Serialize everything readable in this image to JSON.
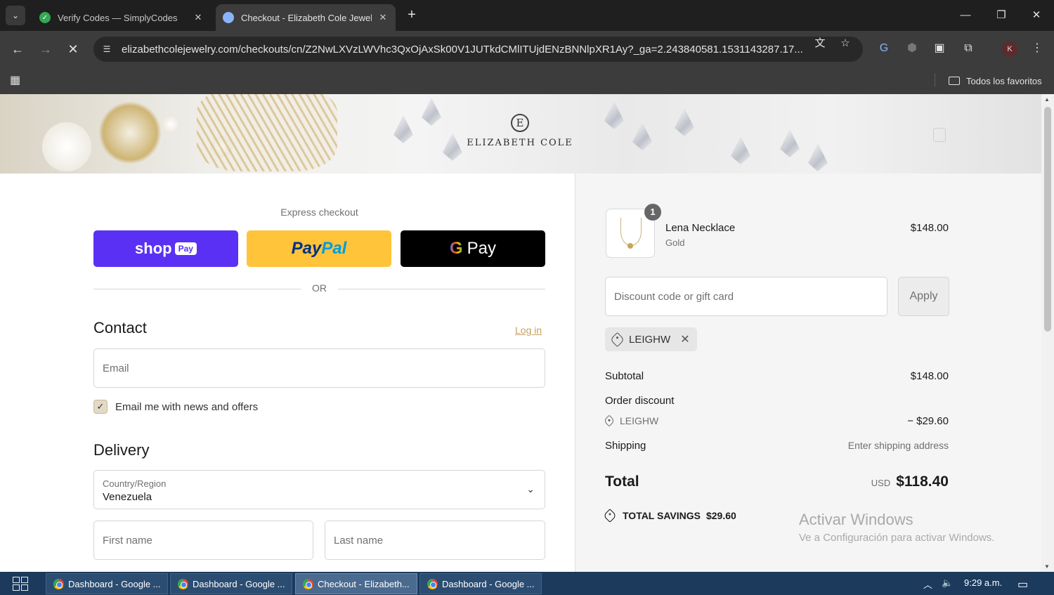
{
  "browser": {
    "tabs": [
      {
        "title": "Verify Codes — SimplyCodes",
        "active": false,
        "favicon_color": "#34a853"
      },
      {
        "title": "Checkout - Elizabeth Cole Jewel",
        "active": true,
        "favicon_color": "#8ab4f8"
      }
    ],
    "url": "elizabethcolejewelry.com/checkouts/cn/Z2NwLXVzLWVhc3QxOjAxSk00V1JUTkdCMlITUjdENzBNNlpXR1Ay?_ga=2.243840581.1531143287.17...",
    "profile_initial": "K",
    "bookmarks_folder": "Todos los favoritos"
  },
  "store": {
    "logo_text": "ELIZABETH COLE",
    "logo_mark": "E"
  },
  "checkout": {
    "express_label": "Express checkout",
    "shop_pay": {
      "word": "shop",
      "badge": "Pay"
    },
    "paypal": {
      "part1": "Pay",
      "part2": "Pal"
    },
    "gpay": {
      "g": "G",
      "pay": "Pay"
    },
    "or_label": "OR",
    "contact_heading": "Contact",
    "login_link": "Log in",
    "email_placeholder": "Email",
    "newsletter_label": "Email me with news and offers",
    "newsletter_checked": true,
    "delivery_heading": "Delivery",
    "country_label": "Country/Region",
    "country_value": "Venezuela",
    "first_name_placeholder": "First name",
    "last_name_placeholder": "Last name"
  },
  "summary": {
    "product": {
      "name": "Lena Necklace",
      "variant": "Gold",
      "price": "$148.00",
      "quantity": "1"
    },
    "discount_placeholder": "Discount code or gift card",
    "apply_label": "Apply",
    "applied_code": "LEIGHW",
    "subtotal_label": "Subtotal",
    "subtotal_value": "$148.00",
    "order_discount_label": "Order discount",
    "discount_code": "LEIGHW",
    "discount_value": "− $29.60",
    "shipping_label": "Shipping",
    "shipping_value": "Enter shipping address",
    "total_label": "Total",
    "total_currency": "USD",
    "total_value": "$118.40",
    "savings_label": "TOTAL SAVINGS",
    "savings_value": "$29.60"
  },
  "watermark": {
    "line1": "Activar Windows",
    "line2": "Ve a Configuración para activar Windows."
  },
  "taskbar": {
    "items": [
      {
        "label": "Dashboard - Google ...",
        "active": false
      },
      {
        "label": "Dashboard - Google ...",
        "active": false
      },
      {
        "label": "Checkout - Elizabeth...",
        "active": true
      },
      {
        "label": "Dashboard - Google ...",
        "active": false
      }
    ],
    "time": "9:29 a.m."
  },
  "colors": {
    "shop_pay": "#5a31f4",
    "paypal": "#ffc439",
    "gpay": "#000000",
    "accent_link": "#c6a25d",
    "checkbox_fill": "#e3d9c6"
  }
}
